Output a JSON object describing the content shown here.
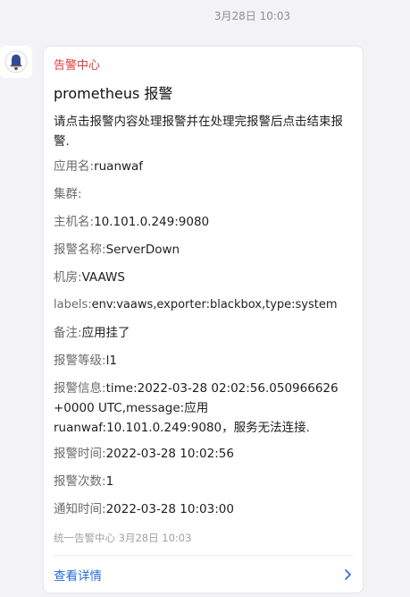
{
  "timestamp": "3月28日 10:03",
  "card": {
    "sender": "告警中心",
    "title": "prometheus 报警",
    "message": "请点击报警内容处理报警并在处理完报警后点击结束报警.",
    "fields": [
      {
        "label": "应用名:",
        "value": "ruanwaf"
      },
      {
        "label": "集群:",
        "value": ""
      },
      {
        "label": "主机名:",
        "value": "10.101.0.249:9080"
      },
      {
        "label": "报警名称:",
        "value": "ServerDown"
      },
      {
        "label": "机房:",
        "value": "VAAWS"
      },
      {
        "label": "labels:",
        "value": "env:vaaws,exporter:blackbox,type:system"
      },
      {
        "label": "备注:",
        "value": "应用挂了"
      },
      {
        "label": "报警等级:",
        "value": "l1"
      },
      {
        "label": "报警信息:",
        "value": "time:2022-03-28 02:02:56.050966626 +0000 UTC,message:应用ruanwaf:10.101.0.249:9080，服务无法连接."
      },
      {
        "label": "报警时间:",
        "value": "2022-03-28 10:02:56"
      },
      {
        "label": "报警次数:",
        "value": "1"
      },
      {
        "label": "通知时间:",
        "value": "2022-03-28 10:03:00"
      }
    ],
    "footer": "统一告警中心  3月28日 10:03",
    "details_label": "查看详情"
  }
}
